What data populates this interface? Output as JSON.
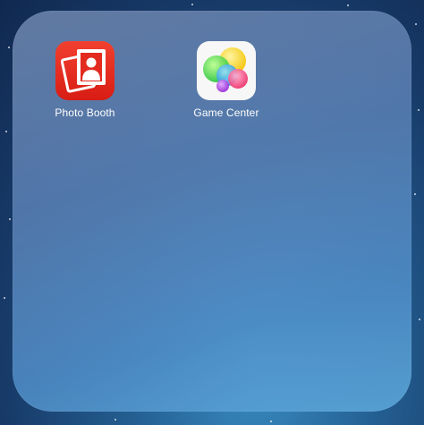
{
  "folder": {
    "apps": [
      {
        "label": "Photo Booth",
        "icon": "photo-booth-icon"
      },
      {
        "label": "Game Center",
        "icon": "game-center-icon"
      }
    ]
  },
  "colors": {
    "photo_booth_red": "#e32a1f",
    "game_center_bg": "#f7f7f7",
    "label_text": "#ffffff"
  }
}
